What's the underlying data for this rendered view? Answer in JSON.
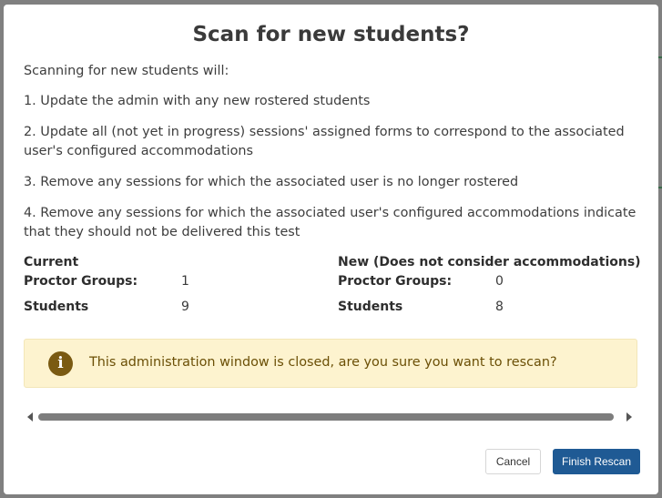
{
  "dialog": {
    "title": "Scan for new students?",
    "intro": "Scanning for new students will:",
    "items": [
      "1. Update the admin with any new rostered students",
      "2. Update all (not yet in progress) sessions' assigned forms to correspond to the associated user's configured accommodations",
      "3. Remove any sessions for which the associated user is no longer rostered",
      "4. Remove any sessions for which the associated user's configured accommodations indicate that they should not be delivered this test"
    ]
  },
  "current": {
    "heading": "Current",
    "proctor_groups_label": "Proctor Groups:",
    "proctor_groups_value": "1",
    "students_label": "Students",
    "students_value": "9"
  },
  "new": {
    "heading": "New (Does not consider accommodations)",
    "proctor_groups_label": "Proctor Groups:",
    "proctor_groups_value": "0",
    "students_label": "Students",
    "students_value": "8"
  },
  "alert": {
    "icon": "info-icon",
    "message": "This administration window is closed, are you sure you want to rescan?",
    "background": "#fdf3cf",
    "text_color": "#6b4f06"
  },
  "buttons": {
    "cancel_label": "Cancel",
    "finish_label": "Finish Rescan",
    "primary_color": "#1f5a94"
  }
}
